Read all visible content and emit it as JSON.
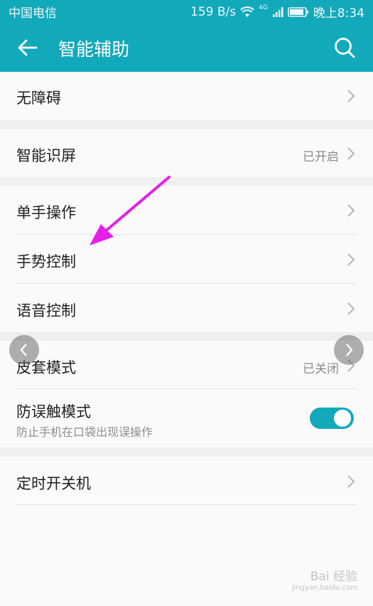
{
  "status_bar": {
    "carrier": "中国电信",
    "speed": "159 B/s",
    "network": "4G",
    "time": "晚上8:34"
  },
  "app_bar": {
    "title": "智能辅助",
    "back_icon": "arrow-left-icon",
    "search_icon": "search-icon"
  },
  "sections": [
    {
      "items": [
        {
          "label": "无障碍"
        }
      ]
    },
    {
      "items": [
        {
          "label": "智能识屏",
          "value": "已开启"
        }
      ]
    },
    {
      "items": [
        {
          "label": "单手操作"
        },
        {
          "label": "手势控制"
        },
        {
          "label": "语音控制"
        }
      ]
    },
    {
      "items": [
        {
          "label": "皮套模式",
          "value": "已关闭"
        },
        {
          "label": "防误触模式",
          "subtitle": "防止手机在口袋出现误操作",
          "toggle_on": true
        }
      ]
    },
    {
      "items": [
        {
          "label": "定时开关机"
        }
      ]
    }
  ],
  "watermark": {
    "main": "Bai 经验",
    "sub": "jingyan.baidu.com"
  },
  "colors": {
    "accent": "#12a9bb",
    "annotation_arrow": "#e61fe6"
  }
}
